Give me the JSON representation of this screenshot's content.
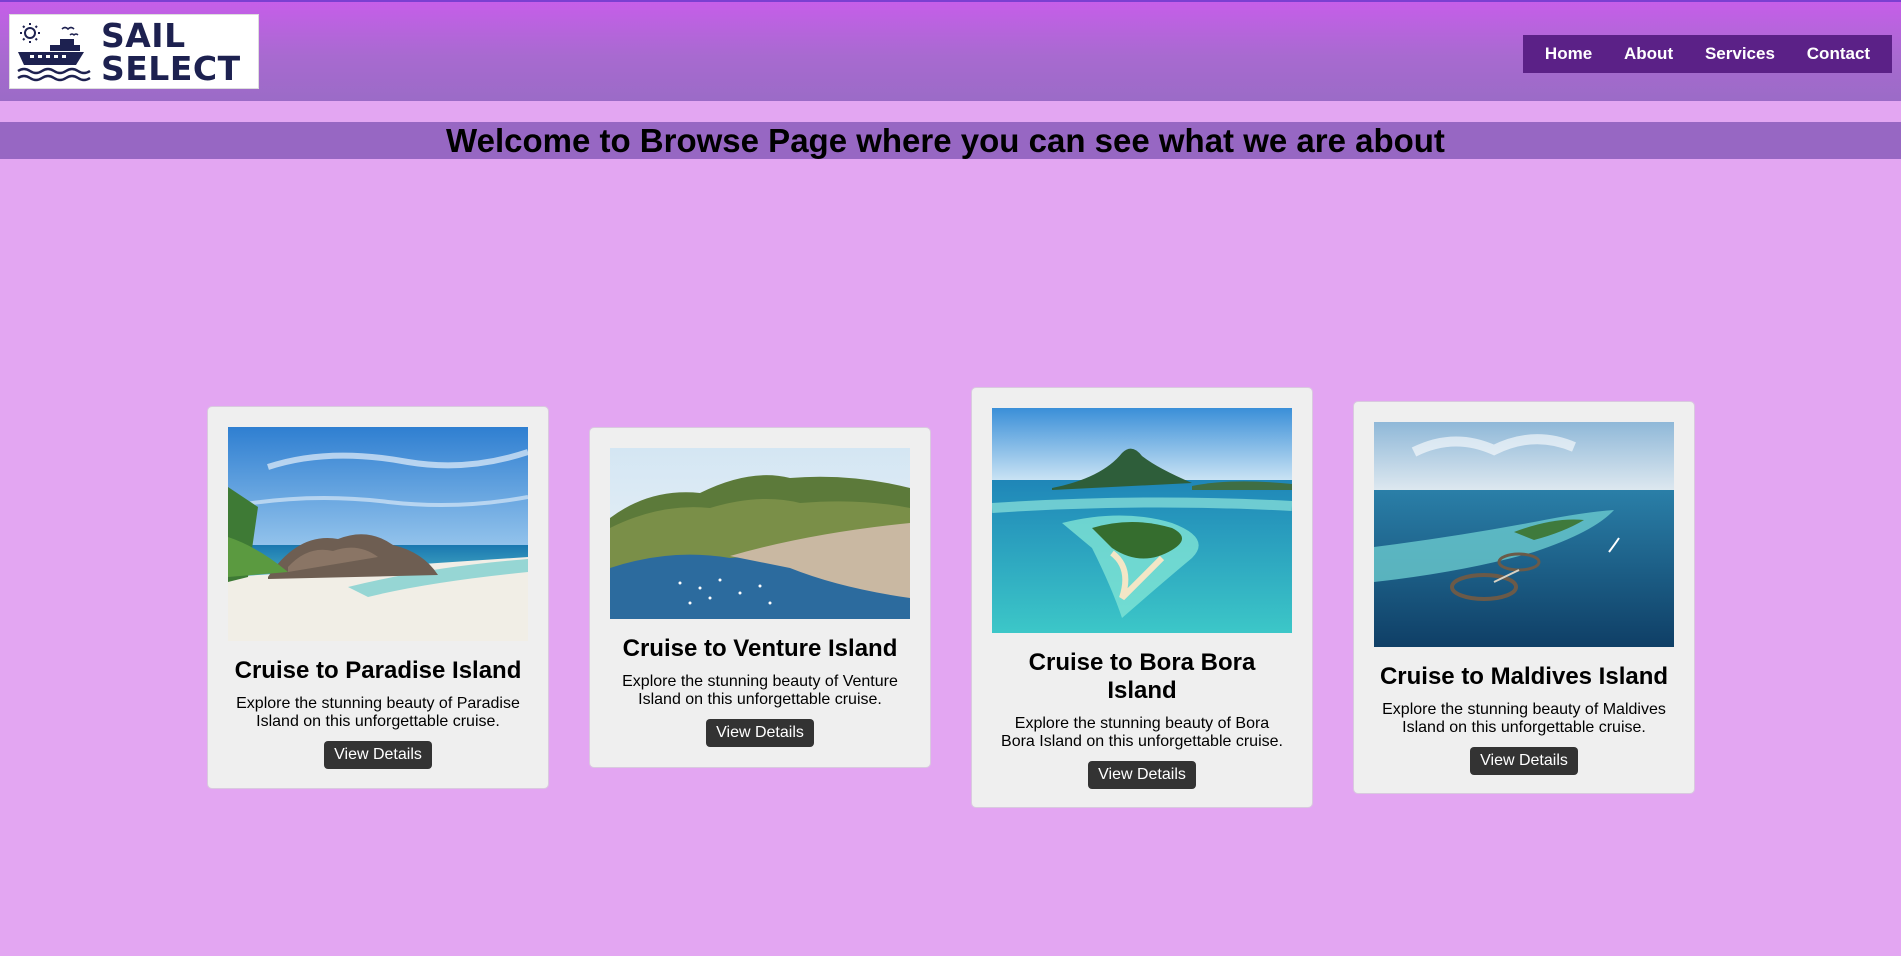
{
  "brand": {
    "line1": "SAIL",
    "line2": "SELECT",
    "text_color": "#1d2150"
  },
  "nav": {
    "items": [
      "Home",
      "About",
      "Services",
      "Contact"
    ],
    "background": "#5b2187"
  },
  "banner": {
    "title": "Welcome to Browse Page where you can see what we are about"
  },
  "cards": [
    {
      "title": "Cruise to Paradise Island",
      "description": "Explore the stunning beauty of Paradise Island on this unforgettable cruise.",
      "button": "View Details",
      "image": "tropical-beach-with-granite-rocks"
    },
    {
      "title": "Cruise to Venture Island",
      "description": "Explore the stunning beauty of Venture Island on this unforgettable cruise.",
      "button": "View Details",
      "image": "harbor-town-with-green-hills"
    },
    {
      "title": "Cruise to Bora Bora Island",
      "description": "Explore the stunning beauty of Bora Bora Island on this unforgettable cruise.",
      "button": "View Details",
      "image": "turquoise-lagoon-with-mountain-island"
    },
    {
      "title": "Cruise to Maldives Island",
      "description": "Explore the stunning beauty of Maldives Island on this unforgettable cruise.",
      "button": "View Details",
      "image": "ocean-resort-with-water-villas"
    }
  ],
  "colors": {
    "page_background": "#e3a6f2",
    "header_gradient_top": "#c65ee9",
    "banner_background": "#9767c3",
    "card_background": "#efefef",
    "button_background": "#333333"
  }
}
